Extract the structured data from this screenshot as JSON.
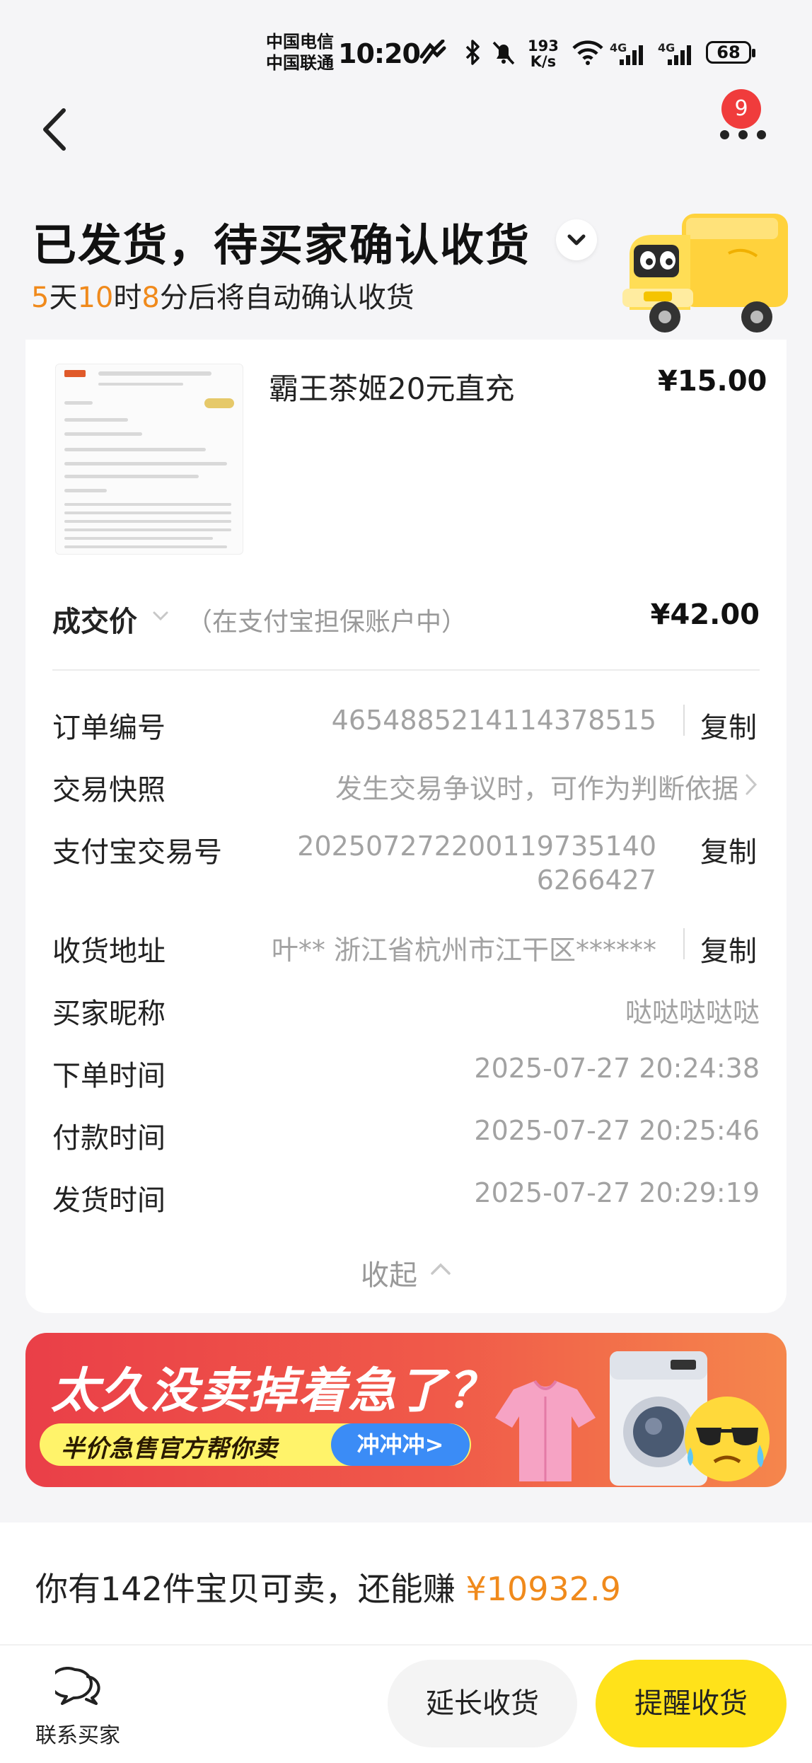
{
  "status_bar": {
    "carrier_1": "中国电信",
    "carrier_2": "中国联通",
    "time": "10:20",
    "net_speed_value": "193",
    "net_speed_unit": "K/s",
    "signal_1": "4G",
    "signal_2": "4G",
    "battery": "68"
  },
  "header": {
    "notification_count": "9"
  },
  "order_status": {
    "title": "已发货，待买家确认收货",
    "countdown_days": "5",
    "countdown_days_unit": "天",
    "countdown_hours": "10",
    "countdown_hours_unit": "时",
    "countdown_minutes": "8",
    "countdown_suffix": "分后将自动确认收货"
  },
  "product": {
    "name": "霸王茶姬20元直充",
    "price": "¥15.00"
  },
  "deal": {
    "label": "成交价",
    "note": "（在支付宝担保账户中）",
    "price": "¥42.00"
  },
  "details": {
    "order_no_label": "订单编号",
    "order_no_value": "4654885214114378515",
    "snapshot_label": "交易快照",
    "snapshot_value": "发生交易争议时，可作为判断依据",
    "alipay_label": "支付宝交易号",
    "alipay_value_line1": "20250727220011973514​0",
    "alipay_value_line2": "6266427",
    "address_label": "收货地址",
    "address_value": "叶** 浙江省杭州市江干区******",
    "buyer_label": "买家昵称",
    "buyer_value": "哒哒哒哒哒",
    "order_time_label": "下单时间",
    "order_time_value": "2025-07-27 20:24:38",
    "pay_time_label": "付款时间",
    "pay_time_value": "2025-07-27 20:25:46",
    "ship_time_label": "发货时间",
    "ship_time_value": "2025-07-27 20:29:19",
    "copy_label": "复制",
    "collapse_label": "收起"
  },
  "banner": {
    "title": "太久没卖掉着急了？",
    "subtitle": "半价急售官方帮你卖",
    "button": "冲冲冲>"
  },
  "earn": {
    "prefix": "你有142件宝贝可卖，还能赚",
    "amount": "¥10932.9"
  },
  "bottom_bar": {
    "contact_label": "联系买家",
    "extend_label": "延长收货",
    "remind_label": "提醒收货"
  },
  "colors": {
    "accent_orange": "#f08a1c",
    "primary_yellow": "#ffe21a",
    "badge_red": "#f03c3c"
  }
}
